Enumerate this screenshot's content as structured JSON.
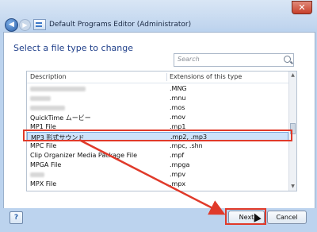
{
  "window": {
    "title": "Default Programs Editor (Administrator)"
  },
  "page": {
    "heading": "Select a file type to change"
  },
  "search": {
    "placeholder": "Search"
  },
  "list": {
    "headers": {
      "description": "Description",
      "extensions": "Extensions of this type"
    },
    "rows": [
      {
        "description": "",
        "extensions": ".MNG"
      },
      {
        "description": "",
        "extensions": ".mnu"
      },
      {
        "description": "",
        "extensions": ".mos"
      },
      {
        "description": "QuickTime ムービー",
        "extensions": ".mov"
      },
      {
        "description": "MP1 File",
        "extensions": ".mp1"
      },
      {
        "description": "MP3 形式サウンド",
        "extensions": ".mp2, .mp3"
      },
      {
        "description": "MPC File",
        "extensions": ".mpc, .shn"
      },
      {
        "description": "Clip Organizer Media Package File",
        "extensions": ".mpf"
      },
      {
        "description": "MPGA File",
        "extensions": ".mpga"
      },
      {
        "description": "",
        "extensions": ".mpv"
      },
      {
        "description": "MPX File",
        "extensions": ".mpx"
      }
    ]
  },
  "buttons": {
    "next": "Next",
    "cancel": "Cancel"
  },
  "icons": {
    "help": "?",
    "close": "✕",
    "back": "◀",
    "forward": "▶"
  }
}
